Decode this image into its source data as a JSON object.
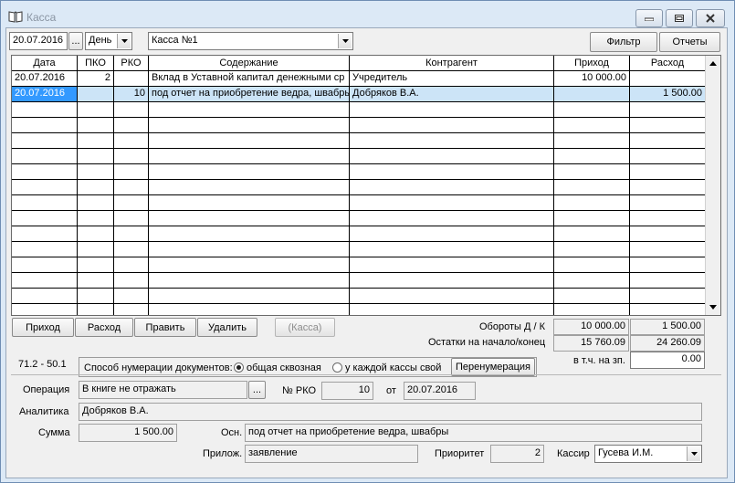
{
  "window": {
    "title": "Касса",
    "icon": "book-icon"
  },
  "toolbar": {
    "date": "20.07.2016",
    "date_picker_label": "...",
    "period": "День",
    "cashbox": "Касса №1",
    "filter_label": "Фильтр",
    "reports_label": "Отчеты"
  },
  "grid": {
    "columns": [
      "Дата",
      "ПКО",
      "РКО",
      "Содержание",
      "Контрагент",
      "Приход",
      "Расход"
    ],
    "rows": [
      {
        "date": "20.07.2016",
        "pko": "2",
        "rko": "",
        "content": "Вклад в Уставной капитал денежными ср",
        "counterparty": "Учредитель",
        "income": "10 000.00",
        "expense": ""
      },
      {
        "date": "20.07.2016",
        "pko": "",
        "rko": "10",
        "content": "под отчет на приобретение ведра, швабры",
        "counterparty": "Добряков В.А.",
        "income": "",
        "expense": "1 500.00"
      }
    ],
    "empty_rows": 14,
    "selected_row": 1
  },
  "actions": {
    "income_label": "Приход",
    "expense_label": "Расход",
    "edit_label": "Править",
    "delete_label": "Удалить",
    "cashbox_label": "(Касса)"
  },
  "totals": {
    "turnover_label": "Обороты Д / К",
    "turnover_debit": "10 000.00",
    "turnover_credit": "1 500.00",
    "balance_label": "Остатки на начало/конец",
    "balance_start": "15 760.09",
    "balance_end": "24 260.09",
    "salary_label": "в т.ч. на зп.",
    "salary_value": "0.00"
  },
  "accounts": "71.2 - 50.1",
  "numbering": {
    "label": "Способ нумерации документов:",
    "option_common": "общая сквозная",
    "option_each": "у каждой кассы свой",
    "selected": "common",
    "renumber_label": "Перенумерация"
  },
  "details": {
    "operation_label": "Операция",
    "operation_value": "В книге не отражать",
    "operation_picker": "...",
    "rko_label": "№ РКО",
    "rko_value": "10",
    "from_label": "от",
    "from_value": "20.07.2016",
    "analytics_label": "Аналитика",
    "analytics_value": "Добряков В.А.",
    "sum_label": "Сумма",
    "sum_value": "1 500.00",
    "basis_label": "Осн.",
    "basis_value": "под отчет на приобретение ведра, швабры",
    "attachment_label": "Прилож.",
    "attachment_value": "заявление",
    "priority_label": "Приоритет",
    "priority_value": "2",
    "cashier_label": "Кассир",
    "cashier_value": "Гусева И.М."
  }
}
